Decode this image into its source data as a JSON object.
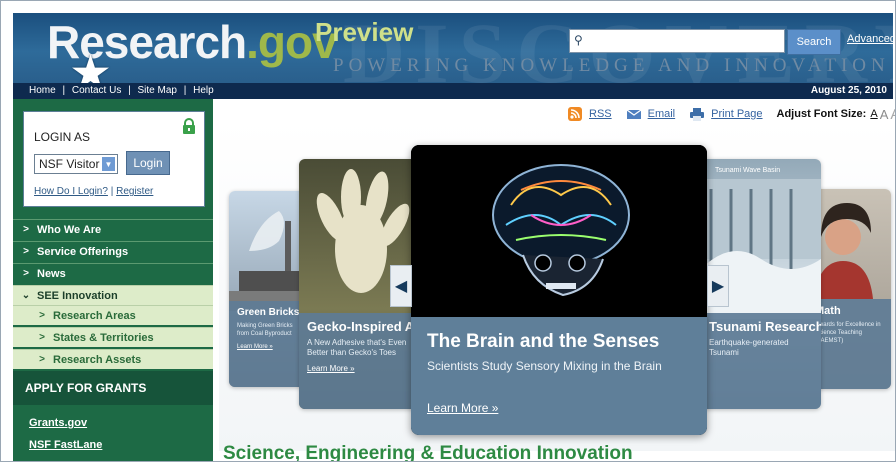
{
  "header": {
    "logo_main": "Research",
    "logo_dot": ".gov",
    "preview": "Preview",
    "tagline": "POWERING KNOWLEDGE AND INNOVATION",
    "watermark": "DISCOVERY",
    "search_placeholder": "",
    "search_button": "Search",
    "advanced_link": "Advanced"
  },
  "navbar": {
    "links": [
      "Home",
      "|",
      "Contact Us",
      "|",
      "Site Map",
      "|",
      "Help"
    ],
    "date": "August 25, 2010"
  },
  "login": {
    "title": "LOGIN AS",
    "select_value": "NSF Visitor",
    "login_button": "Login",
    "how_link": "How Do I Login?",
    "separator": "|",
    "register_link": "Register"
  },
  "sidebar": {
    "items": [
      {
        "label": "Who We Are"
      },
      {
        "label": "Service Offerings"
      },
      {
        "label": "News"
      },
      {
        "label": "SEE Innovation"
      },
      {
        "label": "Research Areas"
      },
      {
        "label": "States & Territories"
      },
      {
        "label": "Research Assets"
      }
    ],
    "apply_heading": "APPLY FOR GRANTS",
    "grant_links": [
      "Grants.gov",
      "NSF FastLane"
    ]
  },
  "tools": {
    "rss": "RSS",
    "email": "Email",
    "print": "Print Page",
    "font_label": "Adjust Font Size:",
    "a_small": "A",
    "a_medium": "A",
    "a_large": "A"
  },
  "carousel": {
    "main": {
      "title": "The Brain and the Senses",
      "subtitle": "Scientists Study Sensory Mixing in the Brain",
      "learn_more": "Learn More »"
    },
    "left1": {
      "title": "Gecko-Inspired Adhesives",
      "subtitle": "A New Adhesive that's Even Better than Gecko's Toes",
      "learn_more": "Learn More »"
    },
    "left2": {
      "title": "Green Bricks from Coal",
      "subtitle": "Making Green Bricks from Coal Byproduct",
      "learn_more": "Learn More »"
    },
    "right1": {
      "title": "Tsunami Research Facility",
      "subtitle": "Earthquake-generated Tsunami",
      "sign": "Tsunami Wave Basin",
      "learn_more": ""
    },
    "right2": {
      "title": "Math",
      "subtitle": "Awards for Excellence in Science Teaching (PAEMST)",
      "learn_more": ""
    }
  },
  "section_title": "Science, Engineering & Education Innovation",
  "colors": {
    "header_blue": "#1b4f7e",
    "nav_dark": "#0e2a4e",
    "sidebar_green": "#1d6a45",
    "sub_green_bg": "#ddecc9",
    "section_title_green": "#2e8a43"
  }
}
